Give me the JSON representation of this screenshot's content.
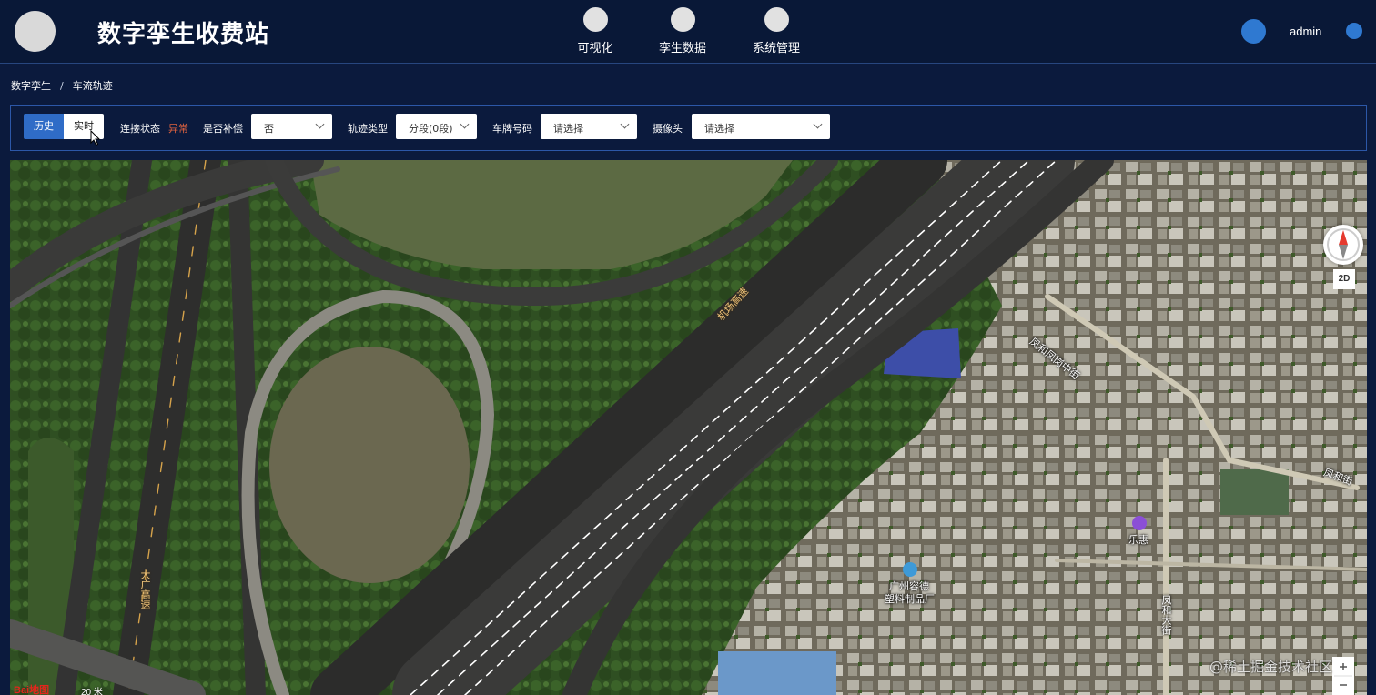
{
  "header": {
    "title": "数字孪生收费站",
    "nav": [
      {
        "label": "可视化"
      },
      {
        "label": "孪生数据"
      },
      {
        "label": "系统管理"
      }
    ],
    "user": "admin"
  },
  "breadcrumb": {
    "root": "数字孪生",
    "separator": "/",
    "current": "车流轨迹"
  },
  "filters": {
    "mode_history": "历史",
    "mode_realtime": "实时",
    "active_mode": "历史",
    "connection_label": "连接状态",
    "connection_status": "异常",
    "compensate_label": "是否补偿",
    "compensate_value": "否",
    "track_type_label": "轨迹类型",
    "track_type_value": "分段(0段)",
    "plate_label": "车牌号码",
    "plate_value": "请选择",
    "camera_label": "摄像头",
    "camera_value": "请选择"
  },
  "map": {
    "mode": "2D",
    "labels": {
      "airport_expressway": "机场高速",
      "guangda_expressway": "大广高速",
      "fenghe_fengzhong": "凤和凤岗中街",
      "fenghe_street": "凤和街",
      "fenghe_avenue": "凤和大街",
      "lehui": "乐惠",
      "factory_line1": "广州容德",
      "factory_line2": "塑料制品厂",
      "watermark": "@稀土掘金技术社区",
      "scale": "20 米",
      "provider": "Bai地图"
    },
    "colors": {
      "status_error": "#e0633f",
      "accent": "#2f6cc7"
    }
  }
}
